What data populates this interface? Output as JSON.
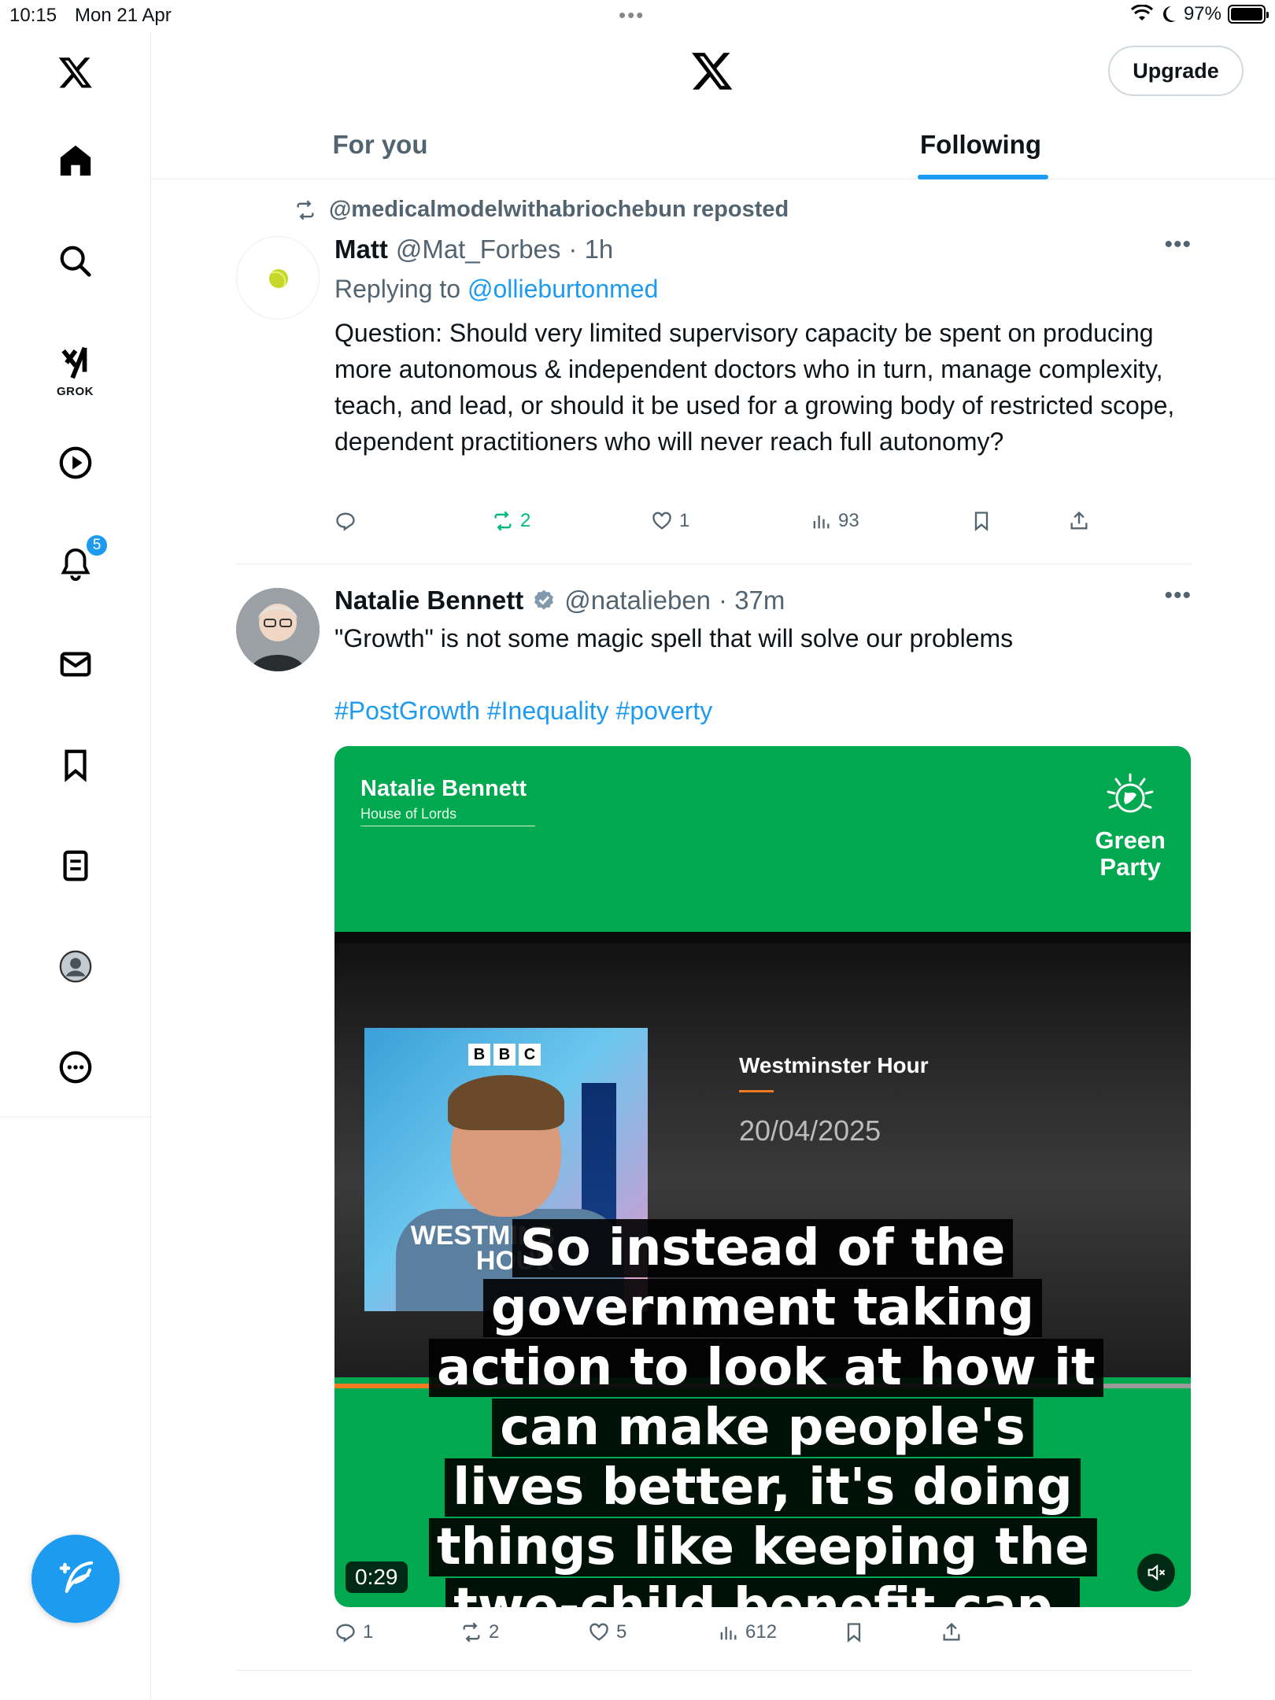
{
  "status_bar": {
    "time": "10:15",
    "date": "Mon 21 Apr",
    "battery": "97%"
  },
  "header": {
    "upgrade_label": "Upgrade",
    "tabs": [
      {
        "label": "For you",
        "active": false
      },
      {
        "label": "Following",
        "active": true
      }
    ]
  },
  "sidebar": {
    "items": [
      "home",
      "search",
      "grok",
      "video",
      "notifications",
      "messages",
      "bookmarks",
      "lists",
      "profile",
      "more"
    ],
    "grok_label": "GROK",
    "notifications_badge": "5"
  },
  "tweets": [
    {
      "repost_label": "@medicalmodelwithabriochebun reposted",
      "name": "Matt",
      "handle": "@Mat_Forbes",
      "time": "· 1h",
      "reply_prefix": "Replying to ",
      "reply_to": "@ollieburtonmed",
      "text": "Question: Should very limited supervisory capacity be spent on producing more autonomous & independent doctors who in turn, manage complexity, teach, and lead, or should it be used for a growing body of restricted scope, dependent practitioners who will never reach full autonomy?",
      "replies": "",
      "reposts": "2",
      "likes": "1",
      "views": "93"
    },
    {
      "name": "Natalie Bennett",
      "handle": "@natalieben",
      "time": "· 37m",
      "text": "\"Growth\" is not some magic spell that will solve our problems",
      "hashtags": "#PostGrowth #Inequality #poverty",
      "video": {
        "overlay_name": "Natalie Bennett",
        "overlay_sub": "House of Lords",
        "party_line1": "Green",
        "party_line2": "Party",
        "bbc": [
          "B",
          "B",
          "C"
        ],
        "thumb_text_line1": "WESTMINS",
        "thumb_text_line2": "HOUR",
        "programme": "Westminster Hour",
        "programme_date": "20/04/2025",
        "caption": "So instead of the government taking action to look at how it can make people's lives better, it's doing things like keeping the two-child benefit cap,",
        "duration": "0:29",
        "progress": 0.12
      },
      "replies": "1",
      "reposts": "2",
      "likes": "5",
      "views": "612"
    }
  ],
  "colors": {
    "accent": "#1d9bf0",
    "repost_green": "#00ba7c",
    "green_party": "#00a94f"
  }
}
